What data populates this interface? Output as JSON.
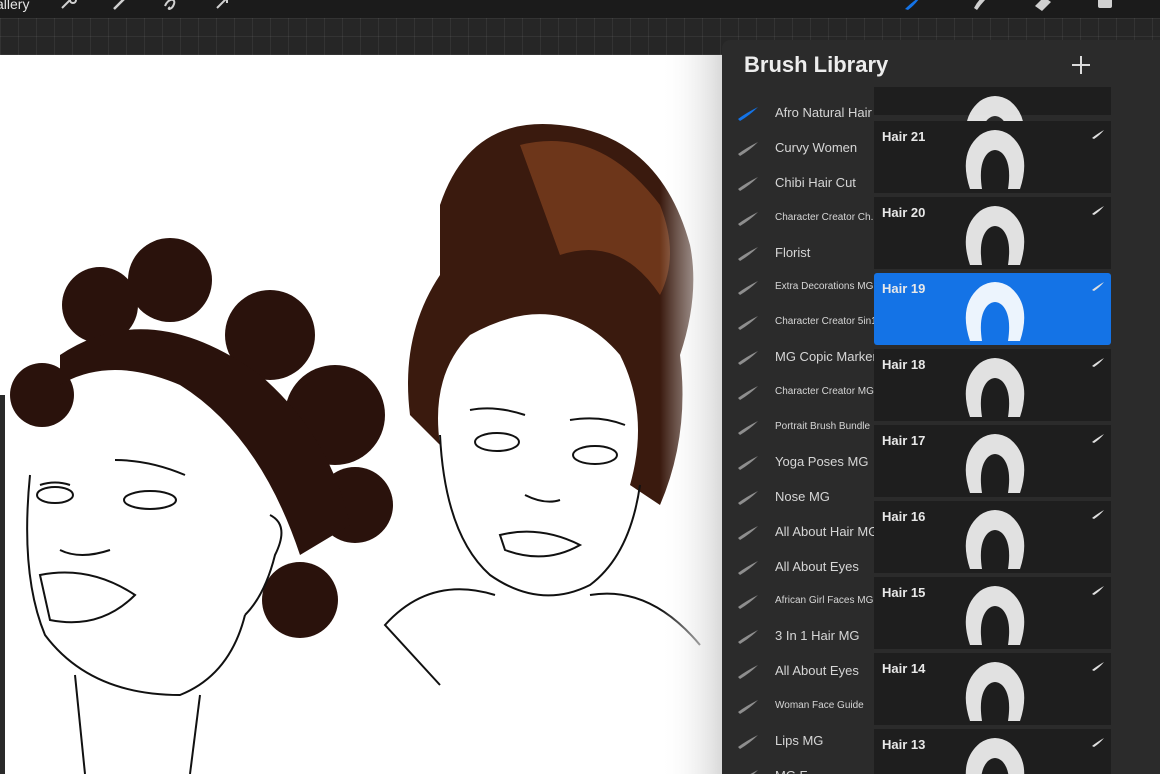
{
  "topbar": {
    "gallery_label": "allery",
    "left_tools": [
      "wrench-icon",
      "magic-wand-icon",
      "selection-icon",
      "transform-icon"
    ],
    "right_tools": [
      "brush-icon",
      "smudge-icon",
      "eraser-icon",
      "layers-icon"
    ],
    "accent": "#1473e6"
  },
  "panel": {
    "title": "Brush Library",
    "add_icon": "plus-icon"
  },
  "brush_sets": [
    {
      "label": "Afro Natural Hair",
      "active": true
    },
    {
      "label": "Curvy Women"
    },
    {
      "label": "Chibi Hair Cut"
    },
    {
      "label": "Character Creator Ch...",
      "small": true
    },
    {
      "label": "Florist"
    },
    {
      "label": "Extra Decorations MG",
      "small": true
    },
    {
      "label": "Character Creator 5in1",
      "small": true
    },
    {
      "label": "MG Copic Markers"
    },
    {
      "label": "Character Creator MG",
      "small": true
    },
    {
      "label": "Portrait Brush Bundle",
      "small": true
    },
    {
      "label": "Yoga Poses MG"
    },
    {
      "label": "Nose MG"
    },
    {
      "label": "All About Hair MG"
    },
    {
      "label": "All About Eyes"
    },
    {
      "label": "African Girl Faces MG",
      "small": true
    },
    {
      "label": "3 In 1 Hair MG"
    },
    {
      "label": "All About Eyes"
    },
    {
      "label": "Woman Face Guide",
      "small": true
    },
    {
      "label": "Lips MG"
    },
    {
      "label": "MG F..."
    }
  ],
  "brushes": [
    {
      "name": "",
      "partial": true
    },
    {
      "name": "Hair 21"
    },
    {
      "name": "Hair 20"
    },
    {
      "name": "Hair 19",
      "selected": true
    },
    {
      "name": "Hair 18"
    },
    {
      "name": "Hair 17"
    },
    {
      "name": "Hair 16"
    },
    {
      "name": "Hair 15"
    },
    {
      "name": "Hair 14"
    },
    {
      "name": "Hair 13"
    }
  ]
}
